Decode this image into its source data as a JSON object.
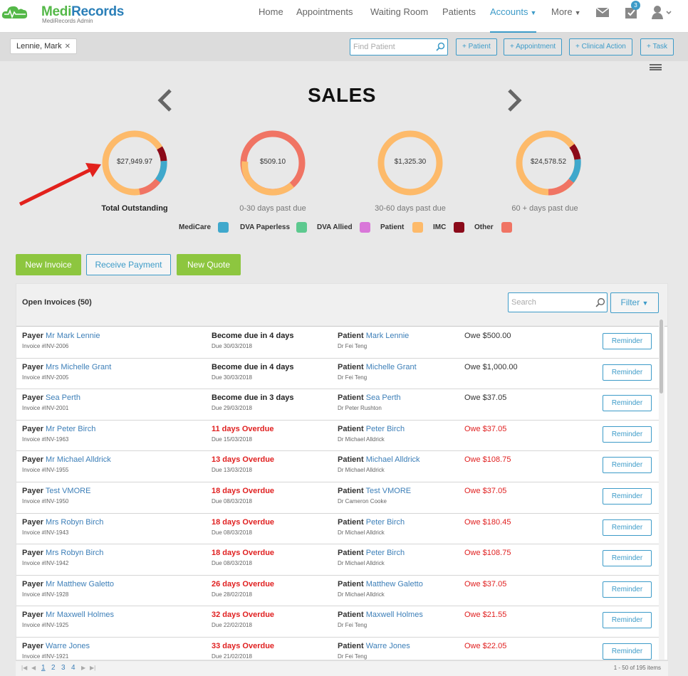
{
  "app": {
    "logo_brand_1": "Medi",
    "logo_brand_2": "Records",
    "logo_subtitle": "MediRecords Admin"
  },
  "nav": {
    "items": [
      "Home",
      "Appointments",
      "Waiting Room",
      "Patients",
      "Accounts",
      "More"
    ],
    "active": "Accounts",
    "tasks_badge": "3"
  },
  "subbar": {
    "patient_tag": "Lennie, Mark",
    "patient_tag_close": "✕",
    "find_patient_placeholder": "Find Patient",
    "add_patient": "+ Patient",
    "add_appointment": "+ Appointment",
    "add_clinical_action": "+ Clinical Action",
    "add_task": "+ Task"
  },
  "sales": {
    "title": "SALES",
    "cards": [
      {
        "value": "$27,949.97",
        "label": "Total Outstanding"
      },
      {
        "value": "$509.10",
        "label": "0-30 days past due"
      },
      {
        "value": "$1,325.30",
        "label": "30-60 days past due"
      },
      {
        "value": "$24,578.52",
        "label": "60 + days past due"
      }
    ],
    "legend": [
      {
        "label": "MediCare",
        "color": "#3fa8cc"
      },
      {
        "label": "DVA Paperless",
        "color": "#5dc98f"
      },
      {
        "label": "DVA Allied",
        "color": "#d977d9"
      },
      {
        "label": "Patient",
        "color": "#fdba6a"
      },
      {
        "label": "IMC",
        "color": "#8b0a1a"
      },
      {
        "label": "Other",
        "color": "#f07464"
      }
    ]
  },
  "actions": {
    "new_invoice": "New Invoice",
    "receive_payment": "Receive Payment",
    "new_quote": "New Quote"
  },
  "invoices": {
    "title": "Open Invoices (50)",
    "search_placeholder": "Search",
    "filter_label": "Filter",
    "payer_key": "Payer",
    "patient_key": "Patient",
    "reminder_label": "Reminder",
    "rows": [
      {
        "payer": "Mr Mark Lennie",
        "invoice": "Invoice #INV-2006",
        "status": "Become due in 4 days",
        "due": "Due 30/03/2018",
        "patient": "Mark Lennie",
        "doctor": "Dr Fei Teng",
        "owe": "Owe $500.00",
        "overdue": false
      },
      {
        "payer": "Mrs Michelle Grant",
        "invoice": "Invoice #INV-2005",
        "status": "Become due in 4 days",
        "due": "Due 30/03/2018",
        "patient": "Michelle Grant",
        "doctor": "Dr Fei Teng",
        "owe": "Owe $1,000.00",
        "overdue": false
      },
      {
        "payer": "Sea Perth",
        "invoice": "Invoice #INV-2001",
        "status": "Become due in 3 days",
        "due": "Due 29/03/2018",
        "patient": "Sea Perth",
        "doctor": "Dr Peter Rushton",
        "owe": "Owe $37.05",
        "overdue": false
      },
      {
        "payer": "Mr Peter Birch",
        "invoice": "Invoice #INV-1963",
        "status": "11 days Overdue",
        "due": "Due 15/03/2018",
        "patient": "Peter Birch",
        "doctor": "Dr Michael Alldrick",
        "owe": "Owe $37.05",
        "overdue": true
      },
      {
        "payer": "Mr Michael Alldrick",
        "invoice": "Invoice #INV-1955",
        "status": "13 days Overdue",
        "due": "Due 13/03/2018",
        "patient": "Michael Alldrick",
        "doctor": "Dr Michael Alldrick",
        "owe": "Owe $108.75",
        "overdue": true
      },
      {
        "payer": "Test VMORE",
        "invoice": "Invoice #INV-1950",
        "status": "18 days Overdue",
        "due": "Due 08/03/2018",
        "patient": "Test VMORE",
        "doctor": "Dr Cameron Cooke",
        "owe": "Owe $37.05",
        "overdue": true
      },
      {
        "payer": "Mrs Robyn Birch",
        "invoice": "Invoice #INV-1943",
        "status": "18 days Overdue",
        "due": "Due 08/03/2018",
        "patient": "Peter Birch",
        "doctor": "Dr Michael Alldrick",
        "owe": "Owe $180.45",
        "overdue": true
      },
      {
        "payer": "Mrs Robyn Birch",
        "invoice": "Invoice #INV-1942",
        "status": "18 days Overdue",
        "due": "Due 08/03/2018",
        "patient": "Peter Birch",
        "doctor": "Dr Michael Alldrick",
        "owe": "Owe $108.75",
        "overdue": true
      },
      {
        "payer": "Mr Matthew Galetto",
        "invoice": "Invoice #INV-1928",
        "status": "26 days Overdue",
        "due": "Due 28/02/2018",
        "patient": "Matthew Galetto",
        "doctor": "Dr Michael Alldrick",
        "owe": "Owe $37.05",
        "overdue": true
      },
      {
        "payer": "Mr Maxwell Holmes",
        "invoice": "Invoice #INV-1925",
        "status": "32 days Overdue",
        "due": "Due 22/02/2018",
        "patient": "Maxwell Holmes",
        "doctor": "Dr Fei Teng",
        "owe": "Owe $21.55",
        "overdue": true
      },
      {
        "payer": "Warre Jones",
        "invoice": "Invoice #INV-1921",
        "status": "33 days Overdue",
        "due": "Due 21/02/2018",
        "patient": "Warre Jones",
        "doctor": "Dr Fei Teng",
        "owe": "Owe $22.05",
        "overdue": true
      }
    ]
  },
  "pager": {
    "pages": [
      "1",
      "2",
      "3",
      "4"
    ],
    "current": "1",
    "info": "1 - 50 of 195 items"
  }
}
